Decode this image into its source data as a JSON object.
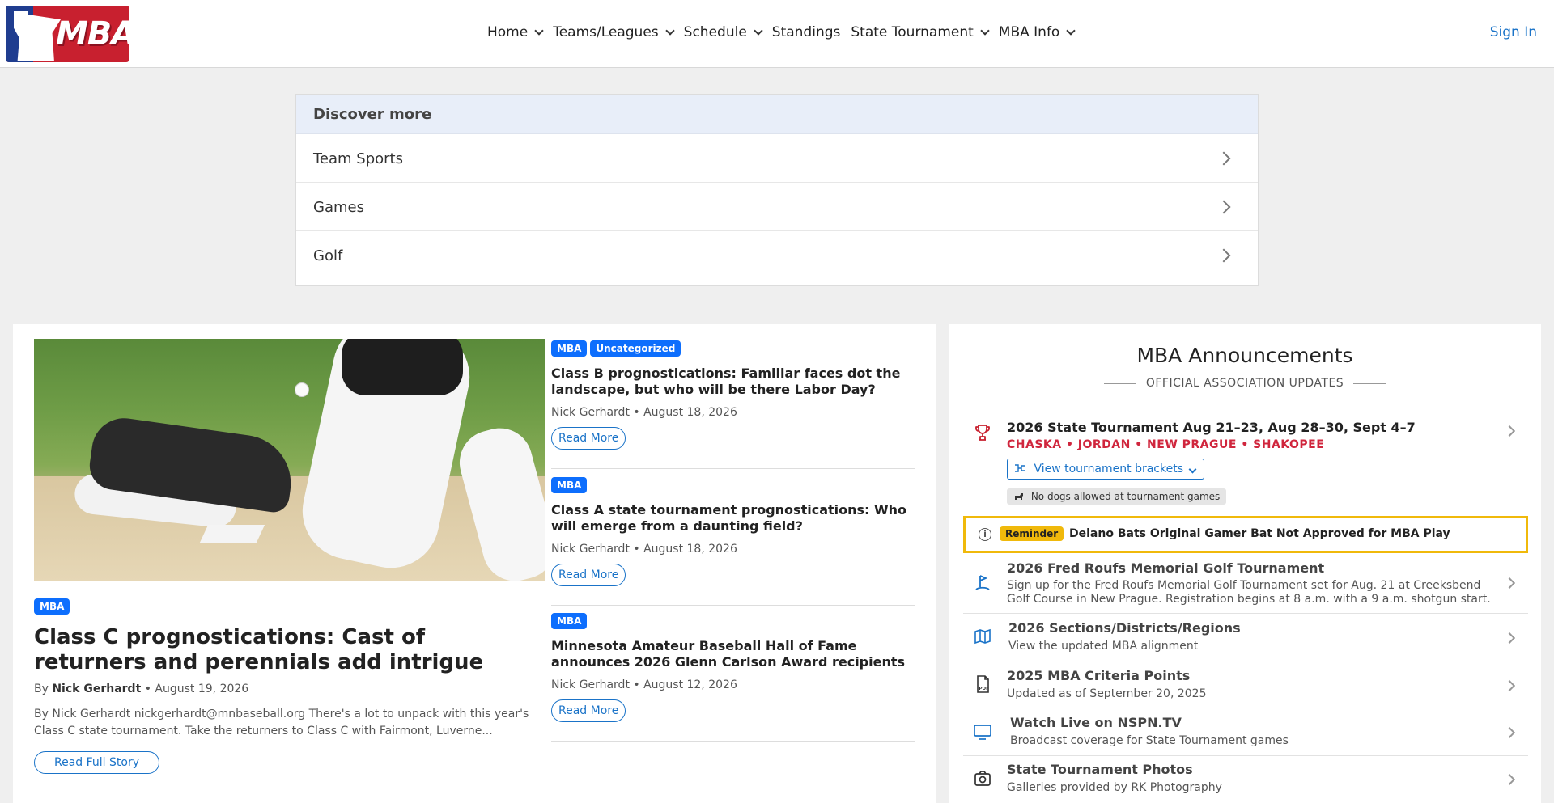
{
  "header": {
    "logo_text": "MBA",
    "nav": [
      {
        "label": "Home"
      },
      {
        "label": "Teams/Leagues"
      },
      {
        "label": "Schedule"
      },
      {
        "label": "Standings"
      },
      {
        "label": "State Tournament"
      },
      {
        "label": "MBA Info"
      }
    ],
    "signin": "Sign In"
  },
  "discover": {
    "title": "Discover more",
    "items": [
      "Team Sports",
      "Games",
      "Golf"
    ]
  },
  "feature": {
    "badge": "MBA",
    "title": "Class C prognostications: Cast of returners and perennials add intrigue",
    "by_prefix": "By",
    "author": "Nick Gerhardt",
    "date": "• August 19, 2026",
    "excerpt": "By Nick Gerhardt nickgerhardt@mnbaseball.org There's a lot to unpack with this year's Class C state tournament. Take the returners to Class C with Fairmont, Luverne...",
    "button": "Read Full Story"
  },
  "articles": [
    {
      "badges": [
        "MBA",
        "Uncategorized"
      ],
      "title": "Class B prognostications: Familiar faces dot the landscape, but who will be there Labor Day?",
      "meta": "Nick Gerhardt • August 18, 2026",
      "button": "Read More"
    },
    {
      "badges": [
        "MBA"
      ],
      "title": "Class A state tournament prognostications: Who will emerge from a daunting field?",
      "meta": "Nick Gerhardt • August 18, 2026",
      "button": "Read More"
    },
    {
      "badges": [
        "MBA"
      ],
      "title": "Minnesota Amateur Baseball Hall of Fame announces 2026 Glenn Carlson Award recipients",
      "meta": "Nick Gerhardt • August 12, 2026",
      "button": "Read More"
    }
  ],
  "announcements": {
    "title": "MBA Announcements",
    "subtitle": "OFFICIAL ASSOCIATION UPDATES",
    "tournament": {
      "title": "2026 State Tournament Aug 21–23, Aug 28–30, Sept 4–7",
      "cities": "CHASKA • JORDAN • NEW PRAGUE • SHAKOPEE",
      "bracket_button": "View tournament brackets",
      "dogs_note": "No dogs allowed at tournament games"
    },
    "reminder": {
      "pill": "Reminder",
      "text": "Delano Bats Original Gamer Bat Not Approved for MBA Play"
    },
    "items": [
      {
        "icon": "golf-icon",
        "title": "2026 Fred Roufs Memorial Golf Tournament",
        "desc": "Sign up for the Fred Roufs Memorial Golf Tournament set for Aug. 21 at Creeksbend Golf Course in New Prague. Registration begins at 8 a.m. with a 9 a.m. shotgun start."
      },
      {
        "icon": "map-icon",
        "title": "2026 Sections/Districts/Regions",
        "desc": "View the updated MBA alignment"
      },
      {
        "icon": "pdf-icon",
        "title": "2025 MBA Criteria Points",
        "desc": "Updated as of September 20, 2025"
      },
      {
        "icon": "tv-icon",
        "title": "Watch Live on NSPN.TV",
        "desc": "Broadcast coverage for State Tournament games"
      },
      {
        "icon": "camera-icon",
        "title": "State Tournament Photos",
        "desc": "Galleries provided by RK Photography"
      }
    ]
  },
  "colors": {
    "accent": "#1a73c8",
    "badge": "#0d6efd",
    "brand_red": "#c8202f",
    "brand_blue": "#1f3d8f",
    "reminder": "#f0b90b",
    "cities": "#d0263d"
  }
}
